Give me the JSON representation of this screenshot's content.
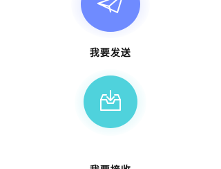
{
  "actions": {
    "send": {
      "label": "我要发送",
      "icon": "paper-plane-icon",
      "color": "#6f8bff"
    },
    "receive": {
      "label": "我要接收",
      "icon": "inbox-download-icon",
      "color": "#4fd2dc"
    }
  }
}
